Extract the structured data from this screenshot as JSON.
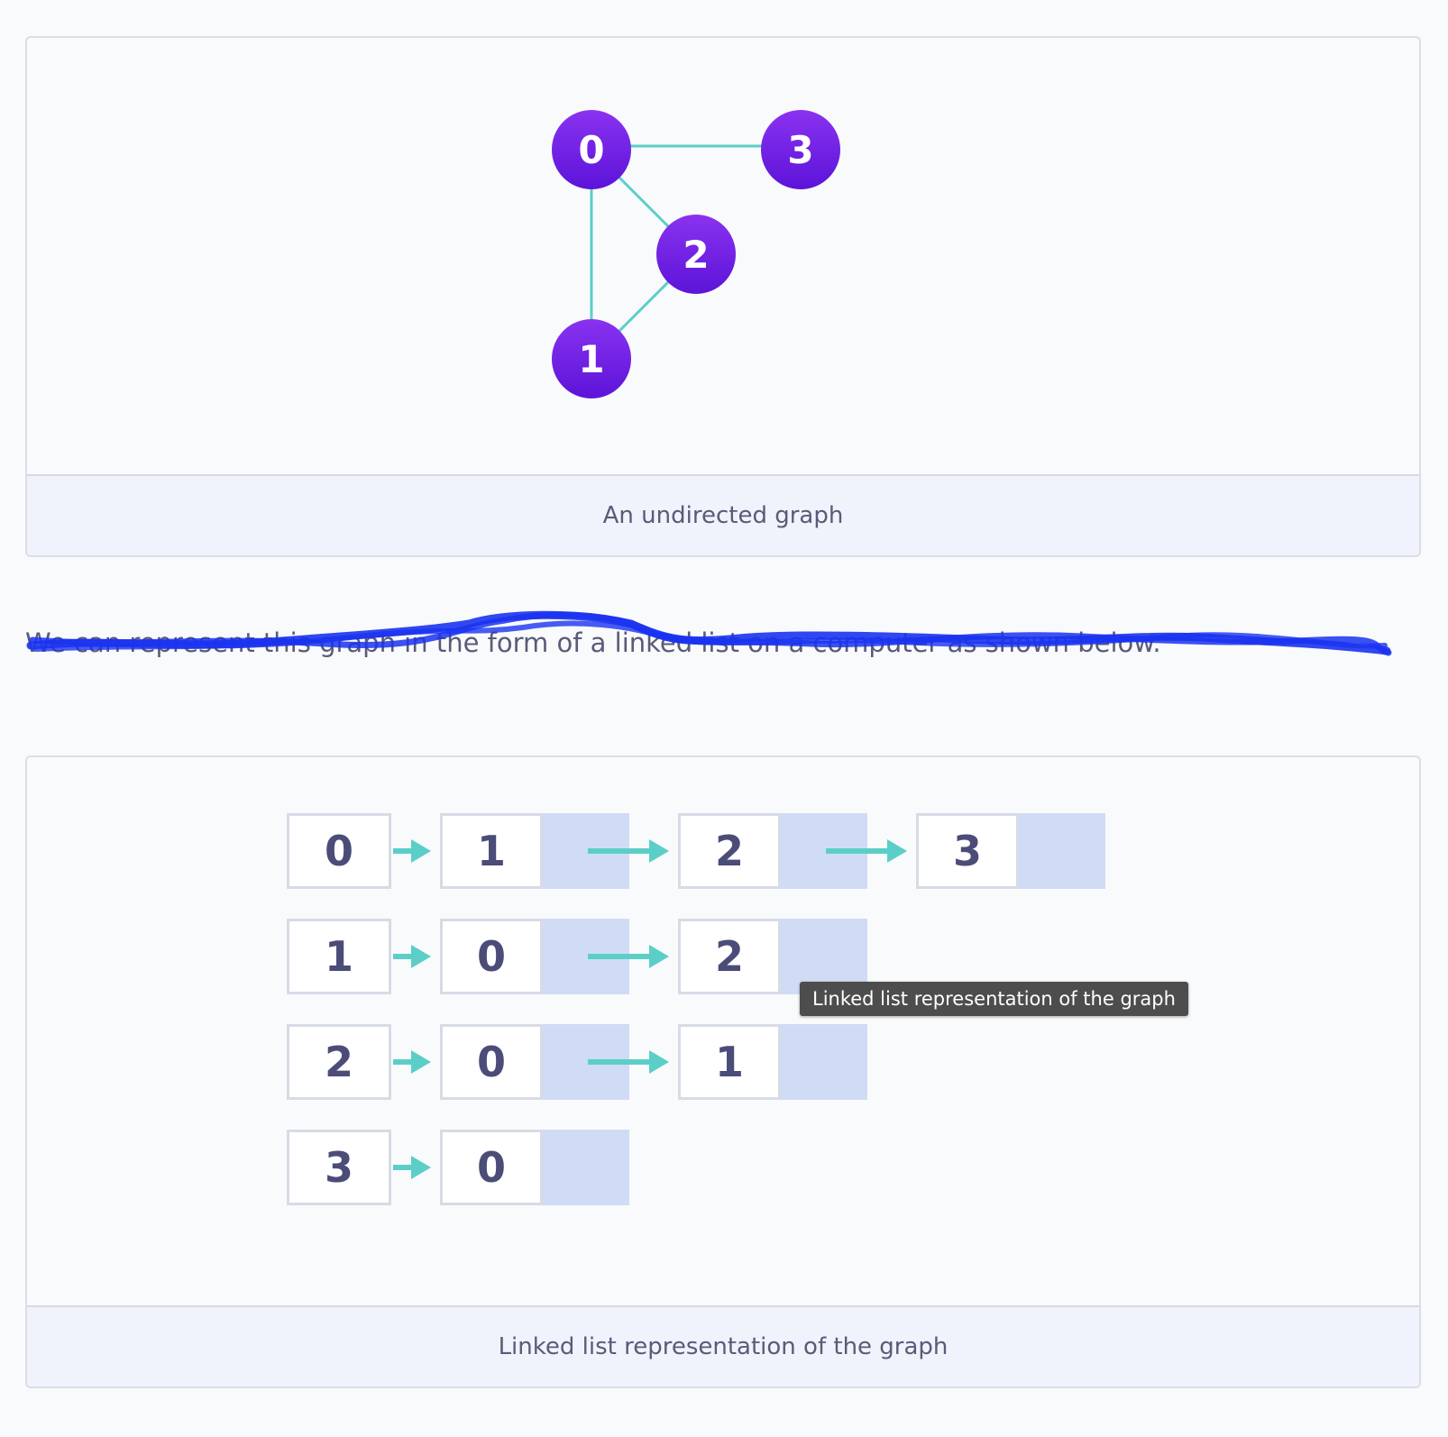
{
  "graph": {
    "nodes": [
      "0",
      "3",
      "2",
      "1"
    ],
    "edges": [
      [
        "0",
        "3"
      ],
      [
        "0",
        "2"
      ],
      [
        "0",
        "1"
      ],
      [
        "2",
        "1"
      ]
    ],
    "caption": "An undirected graph",
    "colors": {
      "node": "#7a25ea",
      "edge": "#5bcfc7",
      "label": "#ffffff"
    }
  },
  "paragraph": "We can represent this graph in the form of a linked list on a computer as shown below.",
  "adjacency": {
    "rows": [
      {
        "head": "0",
        "items": [
          "1",
          "2",
          "3"
        ]
      },
      {
        "head": "1",
        "items": [
          "0",
          "2"
        ]
      },
      {
        "head": "2",
        "items": [
          "0",
          "1"
        ]
      },
      {
        "head": "3",
        "items": [
          "0"
        ]
      }
    ],
    "caption": "Linked list representation of the graph",
    "colors": {
      "cell_border": "#d6dbe6",
      "pointer_fill": "#d0dcf5",
      "arrow": "#5bcfc7",
      "digit": "#4b4c78"
    }
  },
  "tooltip": "Linked list representation of the graph",
  "scribble_color": "#1a33f0"
}
